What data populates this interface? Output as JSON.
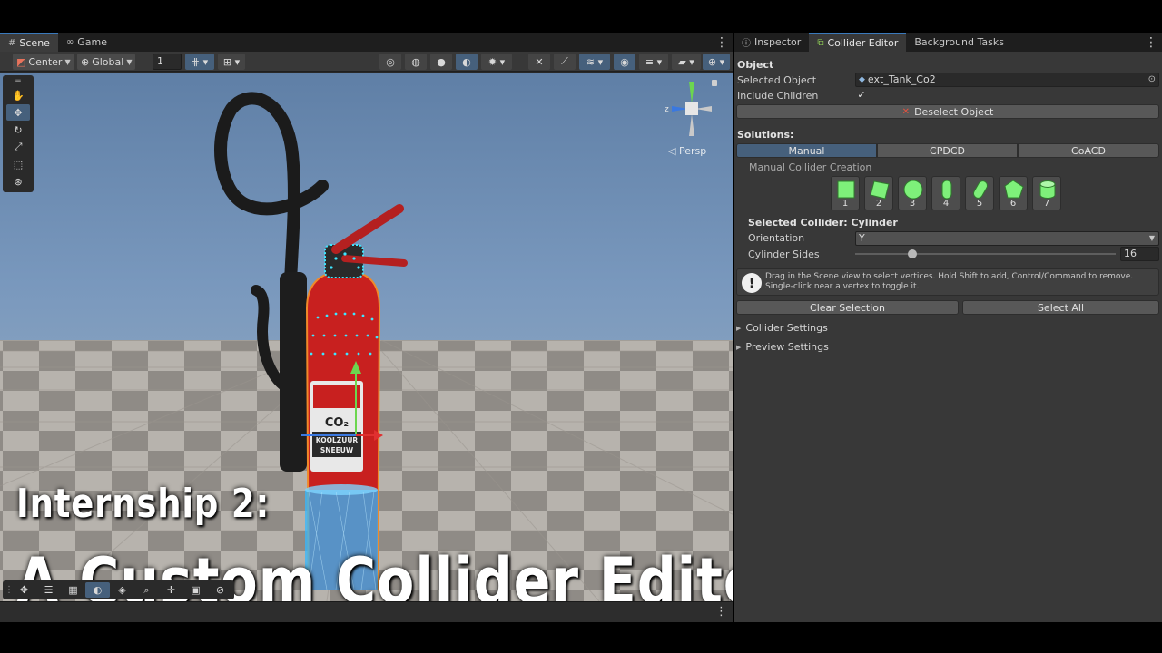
{
  "scene_tabs": [
    {
      "label": "Scene",
      "icon": "grid-icon"
    },
    {
      "label": "Game",
      "icon": "gamepad-icon"
    }
  ],
  "toolbar": {
    "pivot_label": "Center",
    "space_label": "Global",
    "grid_size": "1"
  },
  "viewport": {
    "projection_label": "◁ Persp",
    "axis_z": "z",
    "title_line1": "Internship 2:",
    "title_line2": "A Custom Collider Editor",
    "label_line1": "CO₂",
    "label_line2": "KOOLZUUR",
    "label_line3": "SNEEUW"
  },
  "panel_tabs": [
    {
      "label": "Inspector",
      "icon": "info-icon"
    },
    {
      "label": "Collider Editor",
      "icon": "collider-icon"
    },
    {
      "label": "Background Tasks",
      "icon": ""
    }
  ],
  "inspector": {
    "object_section": "Object",
    "selected_object_label": "Selected Object",
    "selected_object_value": "ext_Tank_Co2",
    "include_children_label": "Include Children",
    "include_children_checked": "✓",
    "deselect_label": "Deselect Object",
    "solutions_label": "Solutions:",
    "solutions": [
      "Manual",
      "CPDCD",
      "CoACD"
    ],
    "active_solution": "Manual",
    "manual_title": "Manual Collider Creation",
    "shapes": [
      {
        "num": "1",
        "icon": "box-collider-icon"
      },
      {
        "num": "2",
        "icon": "rotated-box-collider-icon"
      },
      {
        "num": "3",
        "icon": "sphere-collider-icon"
      },
      {
        "num": "4",
        "icon": "capsule-collider-icon"
      },
      {
        "num": "5",
        "icon": "tilted-capsule-collider-icon"
      },
      {
        "num": "6",
        "icon": "pentagon-collider-icon"
      },
      {
        "num": "7",
        "icon": "cylinder-collider-icon"
      }
    ],
    "selected_collider_label": "Selected Collider: Cylinder",
    "orientation_label": "Orientation",
    "orientation_value": "Y",
    "cylinder_sides_label": "Cylinder Sides",
    "cylinder_sides_value": "16",
    "cylinder_sides_fraction": 0.22,
    "help_text": "Drag in the Scene view to select vertices. Hold Shift to add, Control/Command to remove. Single-click near a vertex to toggle it.",
    "clear_selection_label": "Clear Selection",
    "select_all_label": "Select All",
    "foldouts": [
      "Collider Settings",
      "Preview Settings"
    ]
  },
  "colors": {
    "accent_blue": "#46607c",
    "shape_green": "#7ef07a",
    "selection_cyan": "#3ee6ff",
    "extinguisher_red": "#c8201f"
  }
}
